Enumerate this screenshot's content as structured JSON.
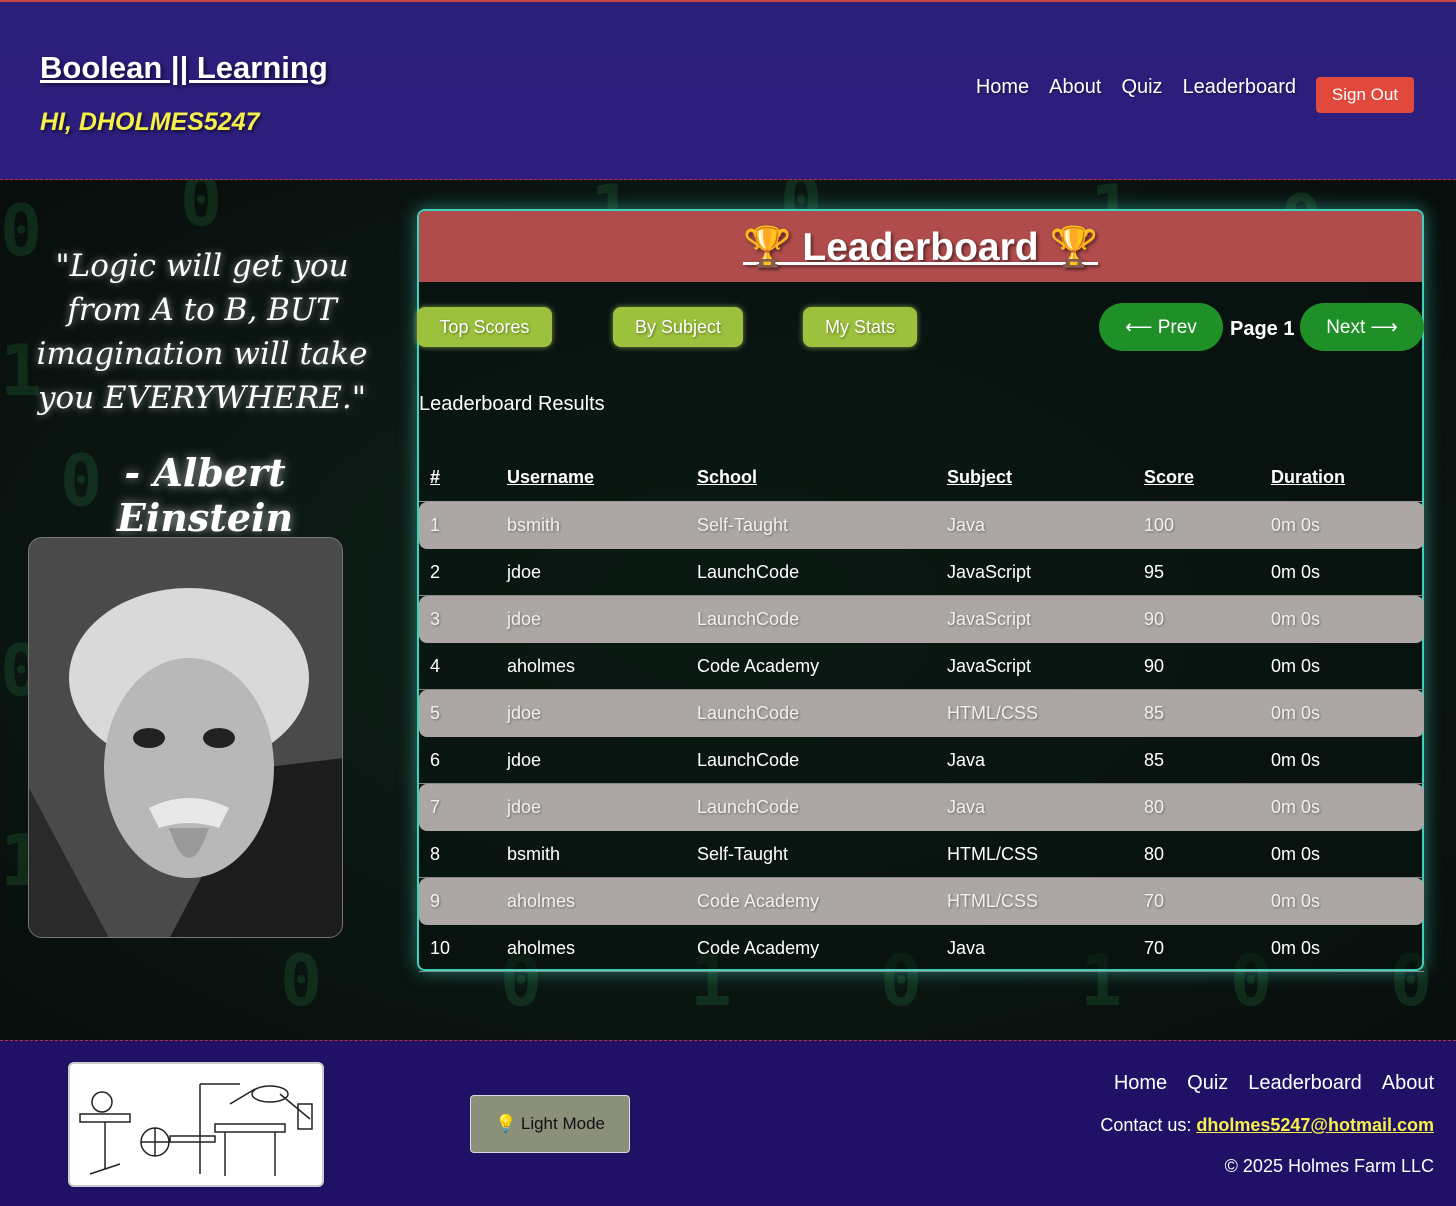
{
  "header": {
    "brand": "Boolean || Learning",
    "greeting": "HI, DHOLMES5247",
    "nav": [
      "Home",
      "About",
      "Quiz",
      "Leaderboard"
    ],
    "sign_out": "Sign Out"
  },
  "sidebar": {
    "quote": "\"Logic will get you from A to B, BUT imagination will take you EVERYWHERE.\"",
    "author": "- Albert Einstein"
  },
  "leaderboard": {
    "title": "🏆 Leaderboard 🏆",
    "filters": [
      "Top Scores",
      "By Subject",
      "My Stats"
    ],
    "prev": "⟵ Prev",
    "next": "Next ⟶",
    "page": "Page 1",
    "results_label": "Leaderboard Results",
    "columns": [
      "#",
      "Username",
      "School",
      "Subject",
      "Score",
      "Duration"
    ],
    "rows": [
      [
        "1",
        "bsmith",
        "Self-Taught",
        "Java",
        "100",
        "0m 0s"
      ],
      [
        "2",
        "jdoe",
        "LaunchCode",
        "JavaScript",
        "95",
        "0m 0s"
      ],
      [
        "3",
        "jdoe",
        "LaunchCode",
        "JavaScript",
        "90",
        "0m 0s"
      ],
      [
        "4",
        "aholmes",
        "Code Academy",
        "JavaScript",
        "90",
        "0m 0s"
      ],
      [
        "5",
        "jdoe",
        "LaunchCode",
        "HTML/CSS",
        "85",
        "0m 0s"
      ],
      [
        "6",
        "jdoe",
        "LaunchCode",
        "Java",
        "85",
        "0m 0s"
      ],
      [
        "7",
        "jdoe",
        "LaunchCode",
        "Java",
        "80",
        "0m 0s"
      ],
      [
        "8",
        "bsmith",
        "Self-Taught",
        "HTML/CSS",
        "80",
        "0m 0s"
      ],
      [
        "9",
        "aholmes",
        "Code Academy",
        "HTML/CSS",
        "70",
        "0m 0s"
      ],
      [
        "10",
        "aholmes",
        "Code Academy",
        "Java",
        "70",
        "0m 0s"
      ]
    ]
  },
  "footer": {
    "light_mode": "💡 Light Mode",
    "nav": [
      "Home",
      "Quiz",
      "Leaderboard",
      "About"
    ],
    "contact_prefix": "Contact us: ",
    "contact_email": "dholmes5247@hotmail.com",
    "copyright": "© 2025 Holmes Farm LLC"
  },
  "colors": {
    "header_bg": "#2c1f7a",
    "greeting": "#f5f04a",
    "sign_out": "#e0493b",
    "title_bar": "#b04c4c",
    "filter_btn": "#9cc13c",
    "pager_btn": "#1f8f28",
    "panel_glow": "#3fcfbb",
    "footer_bg": "#201066"
  }
}
